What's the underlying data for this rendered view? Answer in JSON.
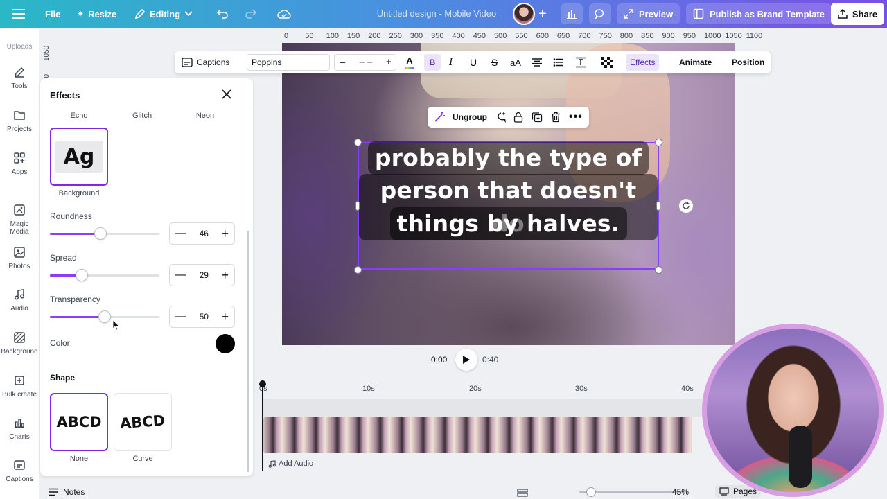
{
  "topbar": {
    "file": "File",
    "resize": "Resize",
    "editing": "Editing",
    "title": "Untitled design - Mobile Video",
    "preview": "Preview",
    "publish": "Publish as Brand Template",
    "share": "Share",
    "brand_gradient": [
      "#2ab8c7",
      "#4a8fe0",
      "#7b4ee6"
    ]
  },
  "rail": {
    "uploads": "Uploads",
    "items": [
      {
        "label": "Tools",
        "icon": "pencil-icon"
      },
      {
        "label": "Projects",
        "icon": "folder-icon"
      },
      {
        "label": "Apps",
        "icon": "apps-grid-icon"
      },
      {
        "label": "Magic Media",
        "icon": "magic-media-icon"
      },
      {
        "label": "Photos",
        "icon": "photo-icon"
      },
      {
        "label": "Audio",
        "icon": "music-note-icon"
      },
      {
        "label": "Background",
        "icon": "background-pattern-icon"
      },
      {
        "label": "Bulk create",
        "icon": "bulk-create-icon"
      },
      {
        "label": "Charts",
        "icon": "bar-chart-icon"
      },
      {
        "label": "Captions",
        "icon": "captions-icon"
      }
    ]
  },
  "effects": {
    "title": "Effects",
    "effect_row": [
      "Echo",
      "Glitch",
      "Neon"
    ],
    "selected_effect": "Background",
    "selected_preview": "Ag",
    "roundness": {
      "label": "Roundness",
      "value": "46",
      "fraction": 0.46
    },
    "spread": {
      "label": "Spread",
      "value": "29",
      "fraction": 0.29
    },
    "transparency": {
      "label": "Transparency",
      "value": "50",
      "fraction": 0.5
    },
    "color": {
      "label": "Color",
      "value": "#000000"
    },
    "shape": {
      "title": "Shape",
      "options": [
        {
          "label": "None",
          "preview": "ABCD",
          "selected": true
        },
        {
          "label": "Curve",
          "preview": "ABCD",
          "selected": false
        }
      ]
    },
    "accent": "#7d2ae8"
  },
  "ruler": {
    "top": [
      "0",
      "50",
      "100",
      "150",
      "200",
      "250",
      "300",
      "350",
      "400",
      "450",
      "500",
      "550",
      "600",
      "650",
      "700",
      "750",
      "800",
      "850",
      "900",
      "950",
      "1000",
      "1050",
      "1100"
    ],
    "left": [
      "1050",
      "00"
    ]
  },
  "format_bar": {
    "captions": "Captions",
    "font": "Poppins",
    "minus": "–",
    "size_placeholder": "– –",
    "plus": "+",
    "bold": "B",
    "italic": "I",
    "underline": "U",
    "strike": "S",
    "case": "aA",
    "effects": "Effects",
    "animate": "Animate",
    "position": "Position"
  },
  "context_bar": {
    "ungroup": "Ungroup"
  },
  "caption": {
    "lines": [
      "probably the type of",
      "person that doesn't do",
      "things by halves."
    ]
  },
  "playback": {
    "current": "0:00",
    "total": "0:40"
  },
  "timeline": {
    "ticks": [
      "0s",
      "10s",
      "20s",
      "30s",
      "40s"
    ],
    "add_audio": "Add Audio"
  },
  "bottombar": {
    "notes": "Notes",
    "zoom": "45%",
    "pages": "Pages"
  }
}
